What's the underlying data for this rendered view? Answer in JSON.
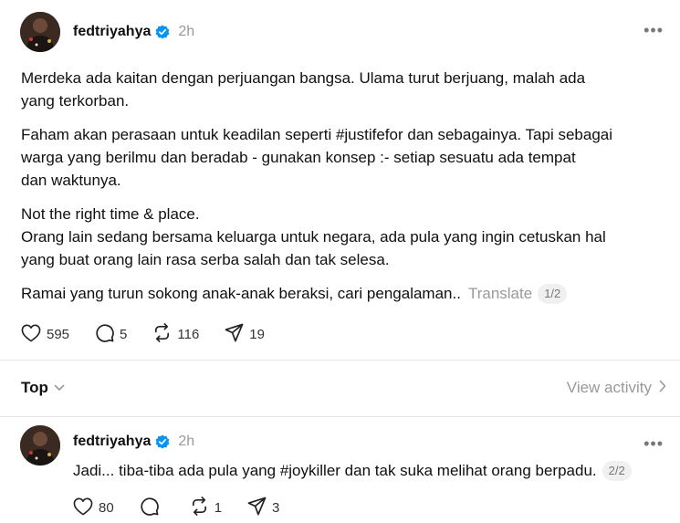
{
  "post": {
    "username": "fedtriyahya",
    "time": "2h",
    "more_label": "•••",
    "paragraphs": [
      [
        "Merdeka ada kaitan dengan perjuangan bangsa. Ulama turut berjuang, malah ada",
        "yang terkorban."
      ],
      [
        "Faham akan perasaan untuk keadilan seperti #justifefor dan sebagainya. Tapi sebagai",
        "warga yang berilmu dan beradab - gunakan konsep :- setiap sesuatu ada tempat",
        "dan waktunya."
      ],
      [
        "Not the right time & place.",
        "Orang lain sedang bersama keluarga untuk negara, ada pula yang ingin cetuskan hal",
        "yang buat orang lain rasa serba salah dan tak selesa."
      ]
    ],
    "last_line": "Ramai yang turun sokong anak-anak beraksi, cari pengalaman..",
    "translate_label": "Translate",
    "page_indicator": "1/2",
    "likes": "595",
    "replies": "5",
    "reposts": "116",
    "shares": "19"
  },
  "sort": {
    "label": "Top",
    "view_activity": "View activity"
  },
  "reply": {
    "username": "fedtriyahya",
    "time": "2h",
    "more_label": "•••",
    "text": "Jadi... tiba-tiba ada pula yang #joykiller dan tak suka melihat orang berpadu.",
    "page_indicator": "2/2",
    "likes": "80",
    "replies": "",
    "reposts": "1",
    "shares": "3"
  },
  "colors": {
    "verified": "#0095f6",
    "muted": "#999999",
    "divider": "#e4e4e4"
  },
  "icons": [
    "heart-icon",
    "comment-icon",
    "repost-icon",
    "share-icon",
    "verified-badge-icon",
    "chevron-down-icon",
    "chevron-right-icon",
    "more-icon"
  ]
}
